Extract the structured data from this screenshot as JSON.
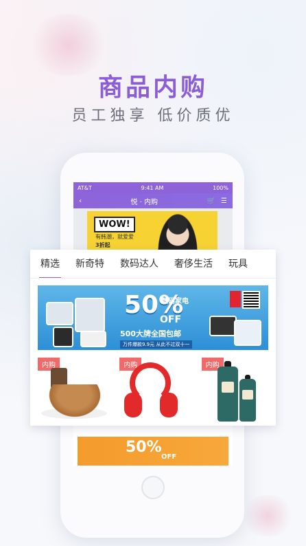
{
  "headline": "商品内购",
  "subline": "员工独享  低价质优",
  "status_bar": {
    "carrier": "AT&T",
    "time": "9:41 AM",
    "battery": "100%"
  },
  "navbar": {
    "title": "悦 · 内购",
    "back_icon": "chevron-left-icon",
    "cart_icon": "cart-icon",
    "menu_icon": "list-icon"
  },
  "hero_banner": {
    "headline": "WOW!",
    "sub": "有韩潮，就爱爱",
    "discount": "3折起"
  },
  "tabs": [
    {
      "label": "精选",
      "active": true
    },
    {
      "label": "新奇特",
      "active": false
    },
    {
      "label": "数码达人",
      "active": false
    },
    {
      "label": "奢侈生活",
      "active": false
    },
    {
      "label": "玩具",
      "active": false
    }
  ],
  "promo_banner": {
    "percent": "50%",
    "category": "数码家电",
    "off": "OFF",
    "slogan": "500大牌全国包邮",
    "fine_print": "万件爆款9.9元 从此不过双十一"
  },
  "products": [
    {
      "badge": "内购",
      "name": "nuts"
    },
    {
      "badge": "内购",
      "name": "headphones"
    },
    {
      "badge": "内购",
      "name": "shampoo"
    }
  ],
  "bottom_banner": {
    "percent": "50%",
    "off": "OFF"
  },
  "colors": {
    "accent": "#8e63da",
    "badge": "#f06a6a",
    "promo_blue": "#2d8fd6",
    "promo_orange": "#f49b2c"
  }
}
